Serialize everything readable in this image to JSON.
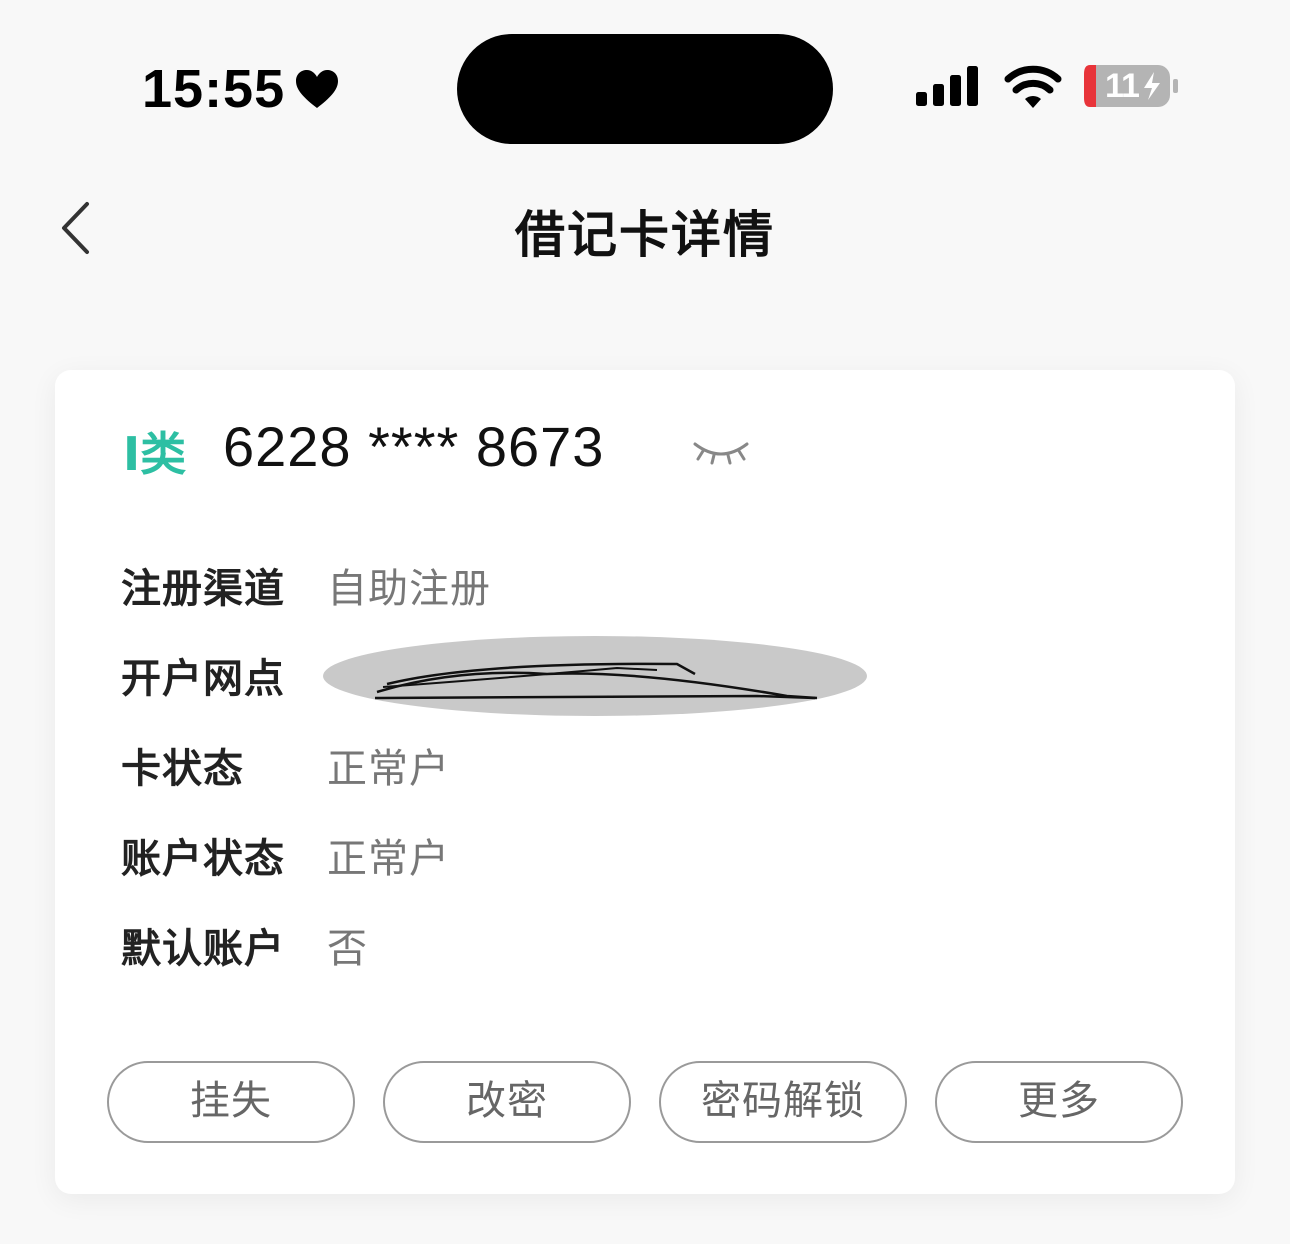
{
  "status_bar": {
    "time": "15:55",
    "battery": "11",
    "icons": [
      "heart-icon",
      "signal-icon",
      "wifi-icon",
      "battery-charging-icon"
    ]
  },
  "header": {
    "title": "借记卡详情",
    "back_icon": "chevron-left-icon"
  },
  "card": {
    "type": "I类",
    "number": "6228 **** 8673",
    "accent_color": "#2dbfa3",
    "eye_icon": "eye-closed-icon",
    "rows": [
      {
        "label": "注册渠道",
        "value": "自助注册"
      },
      {
        "label": "开户网点",
        "value": ""
      },
      {
        "label": "卡状态",
        "value": "正常户"
      },
      {
        "label": "账户状态",
        "value": "正常户"
      },
      {
        "label": "默认账户",
        "value": "否"
      }
    ],
    "actions": [
      "挂失",
      "改密",
      "密码解锁",
      "更多"
    ]
  }
}
